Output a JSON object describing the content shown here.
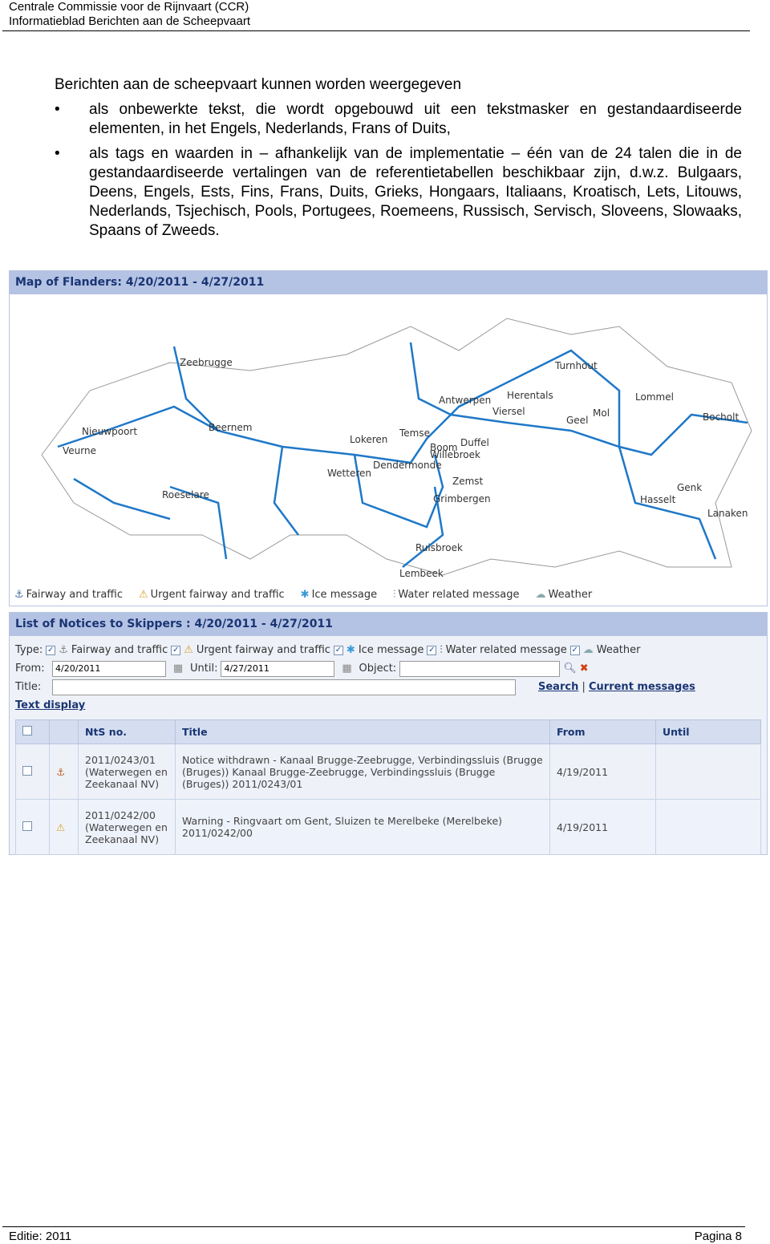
{
  "header": {
    "line1": "Centrale Commissie voor de Rijnvaart (CCR)",
    "line2": "Informatieblad Berichten aan de Scheepvaart"
  },
  "body": {
    "intro": "Berichten aan de scheepvaart kunnen worden weergegeven",
    "bullets": [
      "als onbewerkte tekst, die wordt opgebouwd uit een tekstmasker en gestandaardiseerde elementen, in het Engels, Nederlands, Frans of Duits,",
      "als tags en waarden in – afhankelijk van de implementatie – één van de 24 talen die in de gestandaardiseerde vertalingen van de referentietabellen beschikbaar zijn, d.w.z. Bulgaars, Deens, Engels, Ests, Fins, Frans, Duits, Grieks, Hongaars, Italiaans, Kroatisch, Lets, Litouws, Nederlands, Tsjechisch, Pools, Portugees, Roemeens, Russisch, Servisch, Sloveens, Slowaaks, Spaans of Zweeds."
    ]
  },
  "map": {
    "title": "Map of Flanders: 4/20/2011 - 4/27/2011",
    "places": [
      "Zeebrugge",
      "Turnhout",
      "Antwerpen",
      "Herentals",
      "Lommel",
      "Nieuwpoort",
      "Beernem",
      "Veurne",
      "Lokeren",
      "Temse",
      "Boom",
      "Duffel",
      "Willebroek",
      "Viersel",
      "Mol",
      "Geel",
      "Bocholt",
      "Dendermonde",
      "Wetteren",
      "Zemst",
      "Grimbergen",
      "Genk",
      "Hasselt",
      "Lanaken",
      "Roeselare",
      "Ruisbroek",
      "Lembeek"
    ],
    "legend": [
      {
        "icon": "anchor-icon",
        "label": "Fairway and traffic"
      },
      {
        "icon": "urgent-anchor-icon",
        "label": "Urgent fairway and traffic"
      },
      {
        "icon": "ice-icon",
        "label": "Ice message"
      },
      {
        "icon": "water-gauge-icon",
        "label": "Water related message"
      },
      {
        "icon": "weather-icon",
        "label": "Weather"
      }
    ],
    "river_color": "#1e78c8"
  },
  "list": {
    "title": "List of Notices to Skippers : 4/20/2011 - 4/27/2011",
    "type_label": "Type:",
    "from_label": "From:",
    "from_value": "4/20/2011",
    "until_label": "Until:",
    "until_value": "4/27/2011",
    "object_label": "Object:",
    "title_label": "Title:",
    "search": "Search",
    "sep": "|",
    "current": "Current messages",
    "text_display": "Text display",
    "columns": [
      "NtS no.",
      "Title",
      "From",
      "Until"
    ],
    "rows": [
      {
        "nts": "2011/0243/01 (Waterwegen en Zeekanaal NV)",
        "title": "Notice withdrawn - Kanaal Brugge-Zeebrugge, Verbindingssluis (Brugge (Bruges)) Kanaal Brugge-Zeebrugge, Verbindingssluis (Brugge (Bruges)) 2011/0243/01",
        "from": "4/19/2011",
        "until": ""
      },
      {
        "nts": "2011/0242/00 (Waterwegen en Zeekanaal NV)",
        "title": "Warning - Ringvaart om Gent, Sluizen te Merelbeke (Merelbeke) 2011/0242/00",
        "from": "4/19/2011",
        "until": ""
      }
    ]
  },
  "footer": {
    "left": "Editie: 2011",
    "right": "Pagina 8"
  }
}
